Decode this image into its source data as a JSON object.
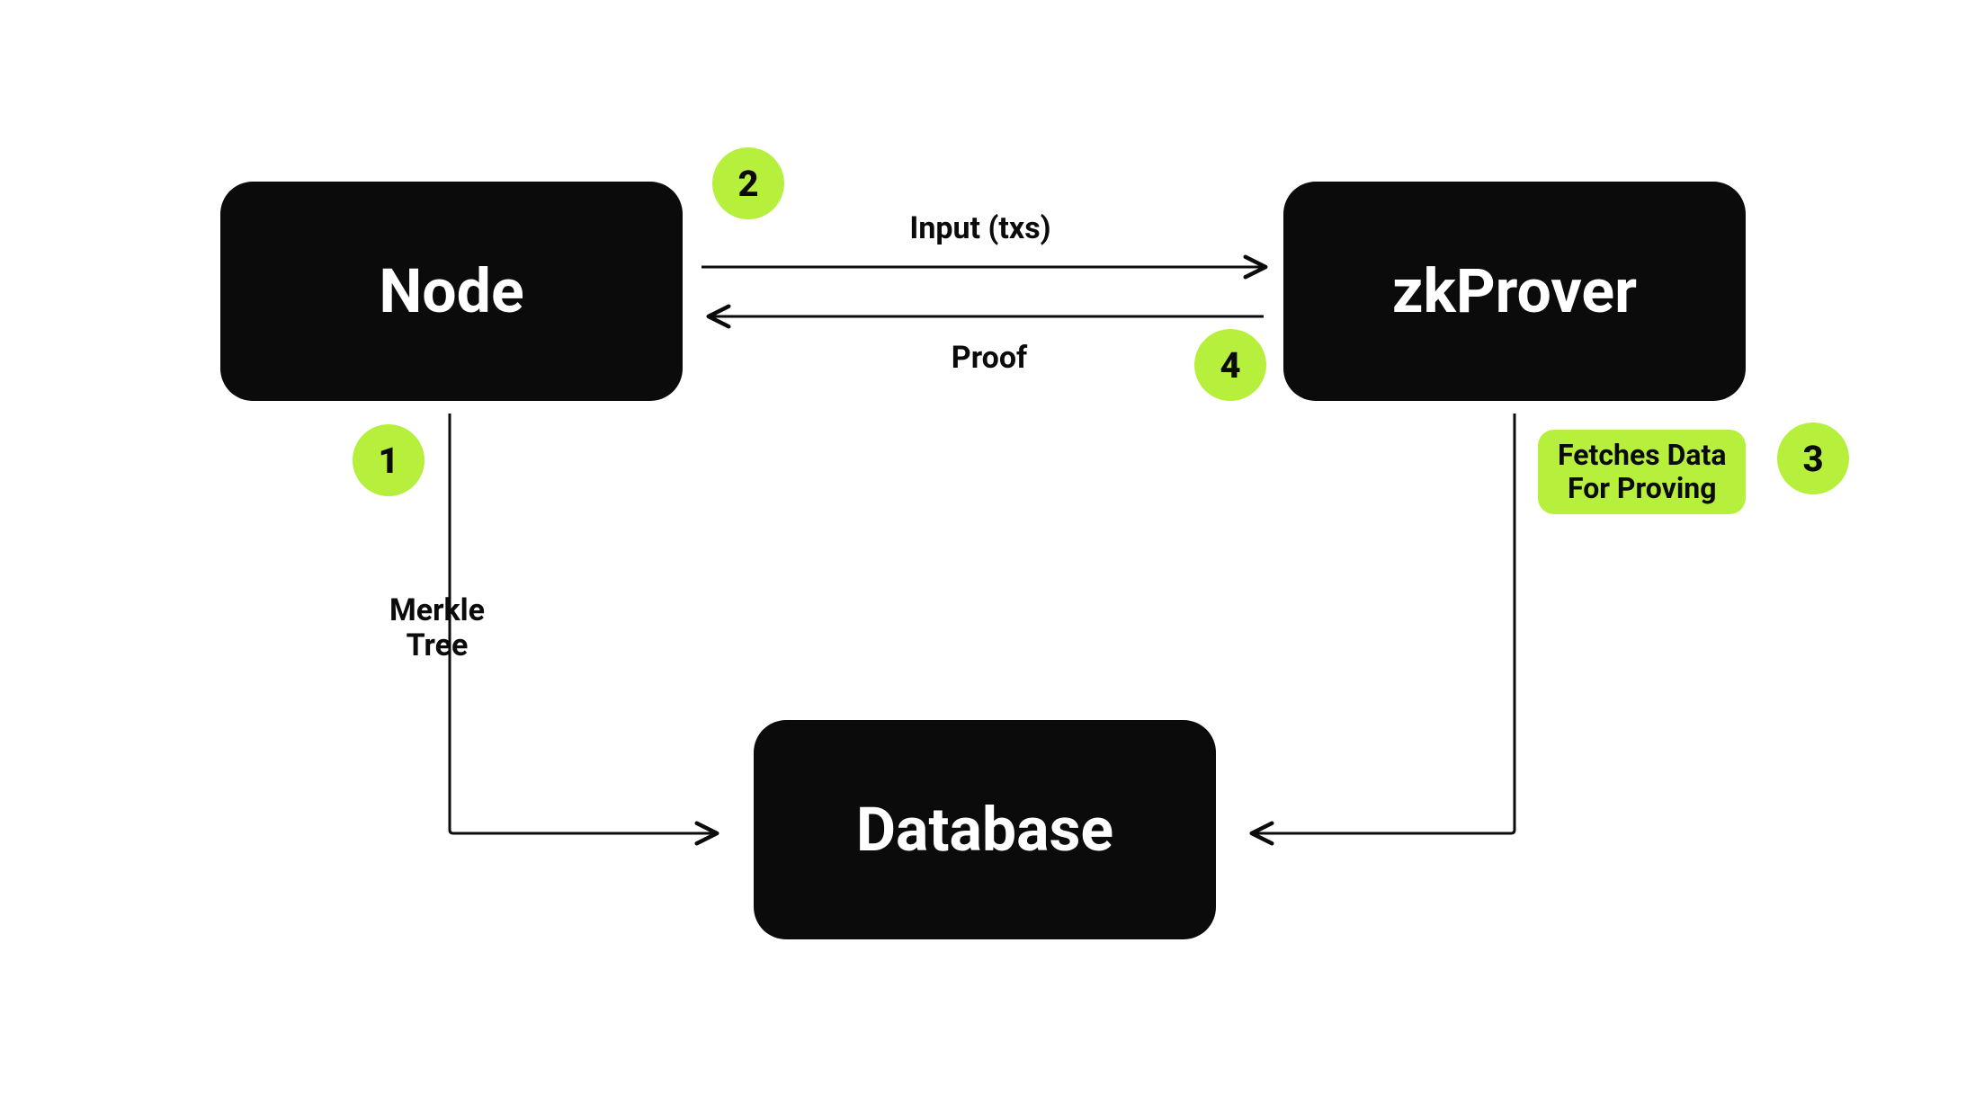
{
  "nodes": {
    "node": {
      "label": "Node"
    },
    "prover": {
      "label": "zkProver"
    },
    "database": {
      "label": "Database"
    }
  },
  "steps": {
    "s1": "1",
    "s2": "2",
    "s3": "3",
    "s4": "4"
  },
  "edges": {
    "input_txs": "Input (txs)",
    "proof": "Proof",
    "merkle_tree": "Merkle\nTree",
    "fetches_data": "Fetches Data\nFor Proving"
  },
  "colors": {
    "accent": "#b6ef3c",
    "box_bg": "#0b0b0b",
    "box_fg": "#ffffff",
    "line": "#0b0b0b"
  }
}
